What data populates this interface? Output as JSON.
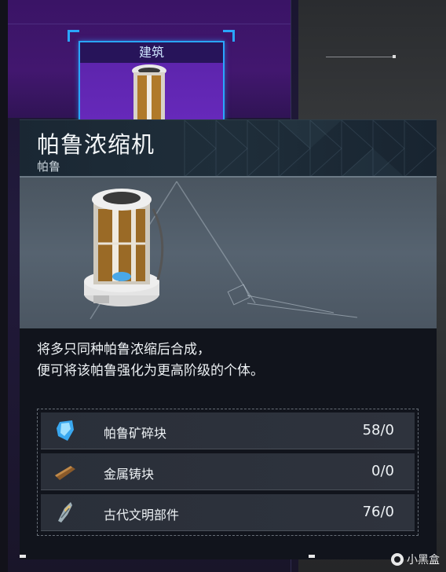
{
  "build_card": {
    "label": "建筑"
  },
  "tooltip": {
    "title": "帕鲁浓缩机",
    "subtitle": "帕鲁",
    "description_lines": [
      "将多只同种帕鲁浓缩后合成，",
      "便可将该帕鲁强化为更高阶级的个体。"
    ]
  },
  "materials": [
    {
      "name": "帕鲁矿碎块",
      "quantity": "58/0",
      "icon": "pal-fluid-crystal-icon"
    },
    {
      "name": "金属铸块",
      "quantity": "0/0",
      "icon": "ingot-icon"
    },
    {
      "name": "古代文明部件",
      "quantity": "76/0",
      "icon": "ancient-part-icon"
    }
  ],
  "watermark": {
    "text": "小黑盒"
  },
  "colors": {
    "accent_blue": "#2aa6ff",
    "build_purple": "#6a2bc0",
    "panel_bg": "#11141c"
  }
}
